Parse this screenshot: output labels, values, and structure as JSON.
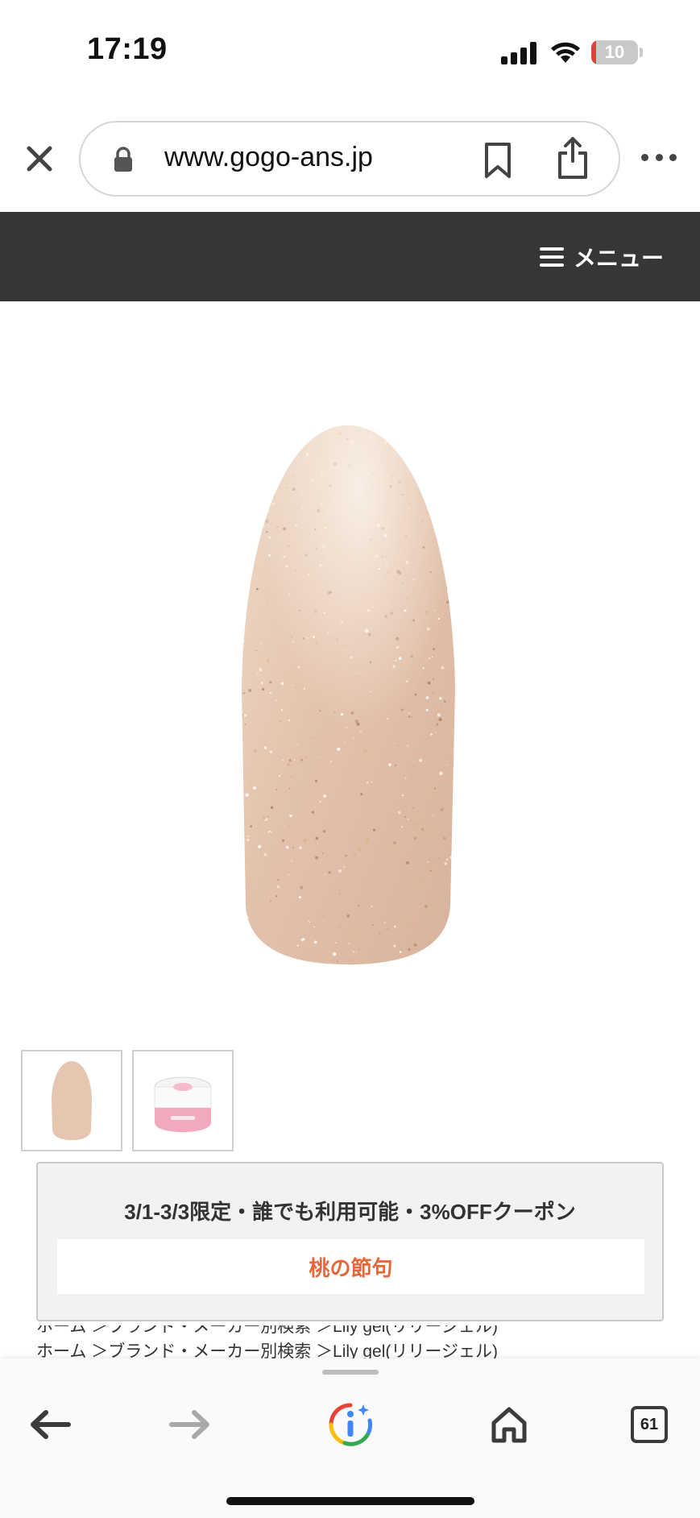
{
  "status_bar": {
    "time": "17:19",
    "battery_level": "10",
    "battery_fraction": 0.1,
    "icons": [
      "signal-icon",
      "wifi-icon",
      "battery-icon"
    ]
  },
  "browser": {
    "url": "www.gogo-ans.jp",
    "icons": [
      "close-icon",
      "lock-icon",
      "bookmark-icon",
      "share-icon",
      "more-icon"
    ]
  },
  "site_header": {
    "menu_label": "メニュー",
    "background": "#363636"
  },
  "product": {
    "main_image": "nail-tip-swatch-beige-glitter",
    "swatch_color": "#e2c0a8",
    "thumbnails": [
      "nail-tip-swatch",
      "lily-gel-jar"
    ]
  },
  "coupon": {
    "title": "3/1-3/3限定・誰でも利用可能・3%OFFクーポン",
    "code": "桃の節句",
    "code_color": "#e4683a"
  },
  "breadcrumb": {
    "text": "ホーム ＞ブランド・メーカー別検索 ＞Lily gel(リリージェル)"
  },
  "toolbar": {
    "tabs_count": "61",
    "icons": [
      "back-arrow-icon",
      "forward-arrow-icon",
      "google-lens-icon",
      "home-icon",
      "tabs-icon"
    ]
  }
}
